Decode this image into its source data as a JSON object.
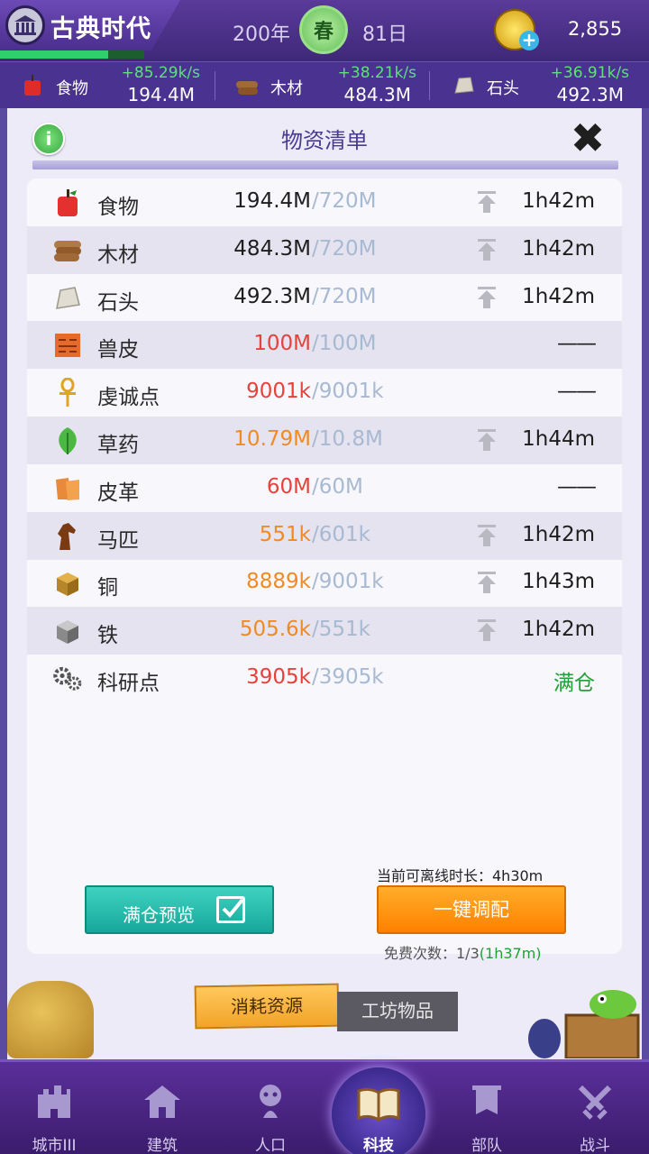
{
  "header": {
    "era_title": "古典时代",
    "era_progress": 0.22,
    "year": "200年",
    "season": "春",
    "day": "81日",
    "gold": "2,855"
  },
  "resources": [
    {
      "name": "食物",
      "rate": "+85.29k/s",
      "amount": "194.4M",
      "icon": "apple-icon"
    },
    {
      "name": "木材",
      "rate": "+38.21k/s",
      "amount": "484.3M",
      "icon": "wood-icon"
    },
    {
      "name": "石头",
      "rate": "+36.91k/s",
      "amount": "492.3M",
      "icon": "stone-icon"
    }
  ],
  "panel": {
    "title": "物资清单",
    "close_glyph": "✖",
    "info_glyph": "i"
  },
  "items": [
    {
      "name": "食物",
      "current": "194.4M",
      "cap": "/720M",
      "time": "1h42m",
      "upgrade": true,
      "color": "#1e1e1e",
      "icon": "apple-icon"
    },
    {
      "name": "木材",
      "current": "484.3M",
      "cap": "/720M",
      "time": "1h42m",
      "upgrade": true,
      "color": "#1e1e1e",
      "icon": "wood-icon"
    },
    {
      "name": "石头",
      "current": "492.3M",
      "cap": "/720M",
      "time": "1h42m",
      "upgrade": true,
      "color": "#1e1e1e",
      "icon": "stone-icon"
    },
    {
      "name": "兽皮",
      "current": "100M",
      "cap": "/100M",
      "time": "——",
      "upgrade": false,
      "color": "#e8413c",
      "icon": "hide-icon"
    },
    {
      "name": "虔诚点",
      "current": "9001k",
      "cap": "/9001k",
      "time": "——",
      "upgrade": false,
      "color": "#e8413c",
      "icon": "ankh-icon"
    },
    {
      "name": "草药",
      "current": "10.79M",
      "cap": "/10.8M",
      "time": "1h44m",
      "upgrade": true,
      "color": "#f08a24",
      "icon": "herb-icon"
    },
    {
      "name": "皮革",
      "current": "60M",
      "cap": "/60M",
      "time": "——",
      "upgrade": false,
      "color": "#e8413c",
      "icon": "leather-icon"
    },
    {
      "name": "马匹",
      "current": "551k",
      "cap": "/601k",
      "time": "1h42m",
      "upgrade": true,
      "color": "#f08a24",
      "icon": "horse-icon"
    },
    {
      "name": "铜",
      "current": "8889k",
      "cap": "/9001k",
      "time": "1h43m",
      "upgrade": true,
      "color": "#f08a24",
      "icon": "copper-icon"
    },
    {
      "name": "铁",
      "current": "505.6k",
      "cap": "/551k",
      "time": "1h42m",
      "upgrade": true,
      "color": "#f08a24",
      "icon": "iron-icon"
    },
    {
      "name": "科研点",
      "current": "3905k",
      "cap": "/3905k",
      "time": "满仓",
      "upgrade": false,
      "color": "#e8413c",
      "time_color": "#22a035",
      "icon": "gears-icon"
    }
  ],
  "actions": {
    "offline_label": "当前可离线时长：4h30m",
    "full_preview": "满仓预览",
    "auto_allocate": "一键调配",
    "free_prefix": "免费次数：1/3",
    "free_time": "(1h37m)"
  },
  "tabs": {
    "consume": "消耗资源",
    "workshop": "工坊物品"
  },
  "nav": [
    {
      "label": "城市III",
      "icon": "castle-icon"
    },
    {
      "label": "建筑",
      "icon": "house-icon"
    },
    {
      "label": "人口",
      "icon": "person-icon"
    },
    {
      "label": "科技",
      "icon": "book-icon",
      "active": true
    },
    {
      "label": "部队",
      "icon": "banner-icon"
    },
    {
      "label": "战斗",
      "icon": "swords-icon"
    }
  ]
}
